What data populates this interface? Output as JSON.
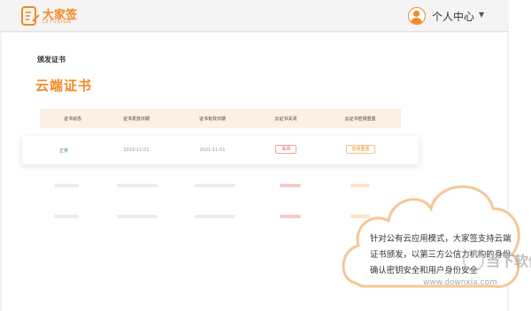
{
  "header": {
    "brand_cn": "大家签",
    "brand_en": "LETUSIGN",
    "user_menu_label": "个人中心",
    "user_menu_caret": "▼"
  },
  "page": {
    "section_label": "颁发证书",
    "title": "云端证书"
  },
  "table": {
    "columns": [
      "证书状态",
      "证书发放日期",
      "证书有效日期",
      "云证书关闭",
      "云证书密钥重置"
    ],
    "row": {
      "status": "正常",
      "issue_date": "2019-11-01",
      "valid_date": "2021-11-01",
      "close_label": "关闭",
      "reset_label": "密钥重置"
    }
  },
  "callout": {
    "lines": [
      "针对公有云应用模式，大家签支持云端",
      "证书颁发，以第三方公信力机构的身份",
      "确认密钥安全和用户身份安全"
    ]
  },
  "watermark": {
    "name": "当下软件园",
    "url": "www.downxia.com"
  },
  "colors": {
    "brand": "#f08a24",
    "status_ok": "#3a9a3a",
    "danger": "#e05050"
  }
}
